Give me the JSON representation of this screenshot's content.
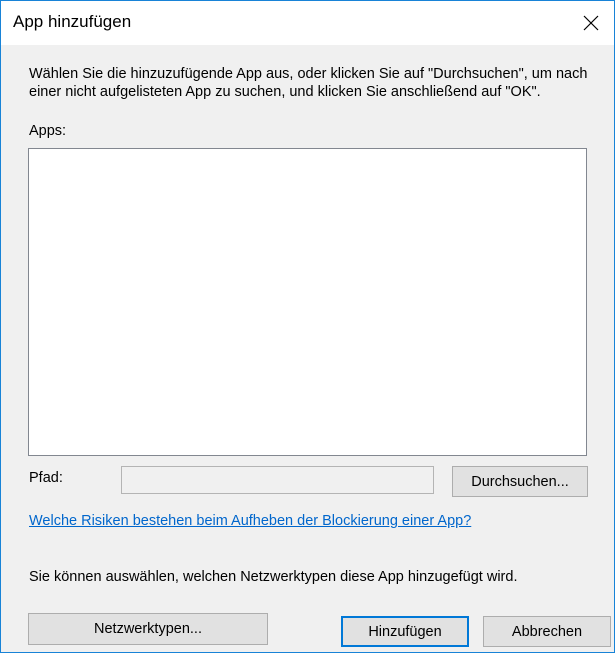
{
  "window": {
    "title": "App hinzufügen",
    "close_icon": "close-icon"
  },
  "instructions": "Wählen Sie die hinzuzufügende App aus, oder klicken Sie auf \"Durchsuchen\", um nach einer nicht aufgelisteten App zu suchen, und klicken Sie anschließend auf \"OK\".",
  "apps": {
    "label": "Apps:",
    "items": []
  },
  "path": {
    "label": "Pfad:",
    "value": "",
    "browse_label": "Durchsuchen..."
  },
  "risk_link": "Welche Risiken bestehen beim Aufheben der Blockierung einer App?",
  "info_text": "Sie können auswählen, welchen Netzwerktypen diese App hinzugefügt wird.",
  "buttons": {
    "network_types": "Netzwerktypen...",
    "add": "Hinzufügen",
    "cancel": "Abbrechen"
  },
  "colors": {
    "accent": "#0078d7",
    "link": "#0066cc",
    "window_border": "#1883d7",
    "background": "#f0f0f0"
  }
}
